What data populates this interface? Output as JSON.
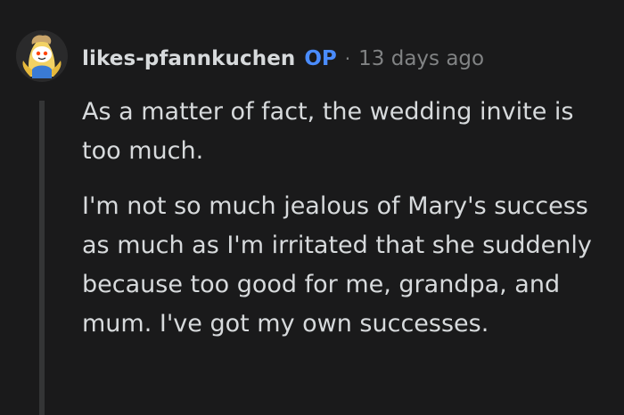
{
  "comment": {
    "username": "likes-pfannkuchen",
    "op_badge": "OP",
    "separator": "·",
    "timestamp": "13 days ago",
    "paragraphs": [
      "As a matter of fact, the wedding invite is too much.",
      "I'm not so much jealous of Mary's success as much as I'm irritated that she suddenly because too good for me, grandpa, and mum. I've got my own successes."
    ]
  },
  "colors": {
    "background": "#1a1a1b",
    "text": "#d7dadc",
    "op_badge": "#4a8cff",
    "meta": "#818384",
    "thread_line": "#343536"
  },
  "icons": {
    "avatar": "snoo-banana-avatar-icon"
  }
}
